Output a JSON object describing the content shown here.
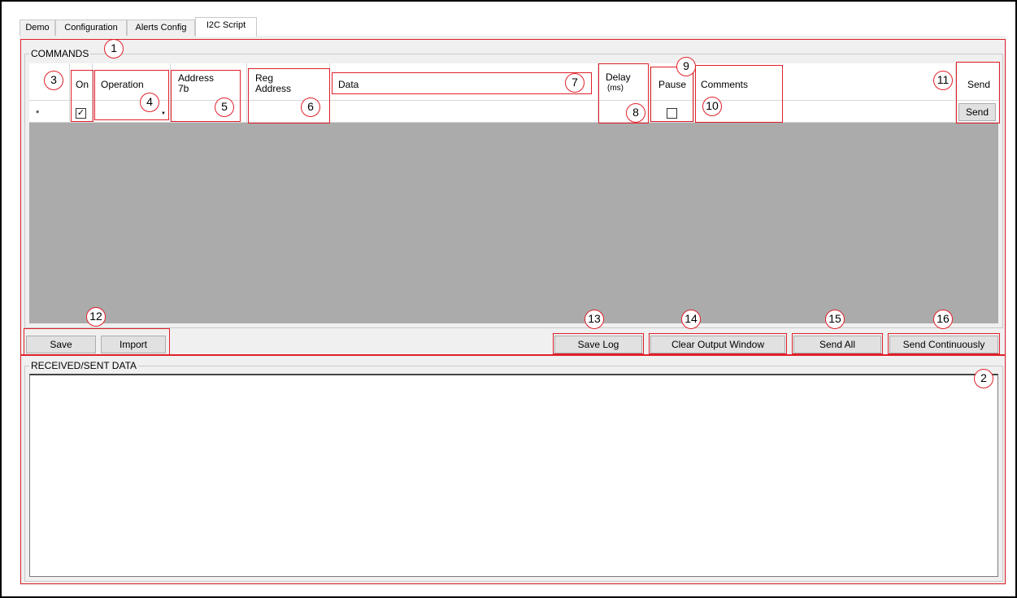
{
  "tabs": [
    "Demo",
    "Configuration",
    "Alerts Config",
    "I2C Script"
  ],
  "commands": {
    "title": "COMMANDS",
    "headers": {
      "on": "On",
      "operation": "Operation",
      "address_line1": "Address",
      "address_line2": "7b",
      "reg_line1": "Reg",
      "reg_line2": "Address",
      "data": "Data",
      "delay_line1": "Delay",
      "delay_line2": "(ms)",
      "pause": "Pause",
      "comments": "Comments",
      "send": "Send"
    },
    "new_row": {
      "marker": "*",
      "on_checked": true,
      "pause_checked": false,
      "send_label": "Send"
    },
    "buttons": {
      "save": "Save",
      "import": "Import",
      "save_log": "Save Log",
      "clear_output": "Clear Output Window",
      "send_all": "Send All",
      "send_continuously": "Send Continuously"
    }
  },
  "received": {
    "title": "RECEIVED/SENT DATA"
  },
  "callouts": [
    "1",
    "2",
    "3",
    "4",
    "5",
    "6",
    "7",
    "8",
    "9",
    "10",
    "11",
    "12",
    "13",
    "14",
    "15",
    "16"
  ],
  "colors": {
    "annotation_red": "#e0202a",
    "grid_gray": "#ababab",
    "panel_bg": "#f0f0f0"
  }
}
